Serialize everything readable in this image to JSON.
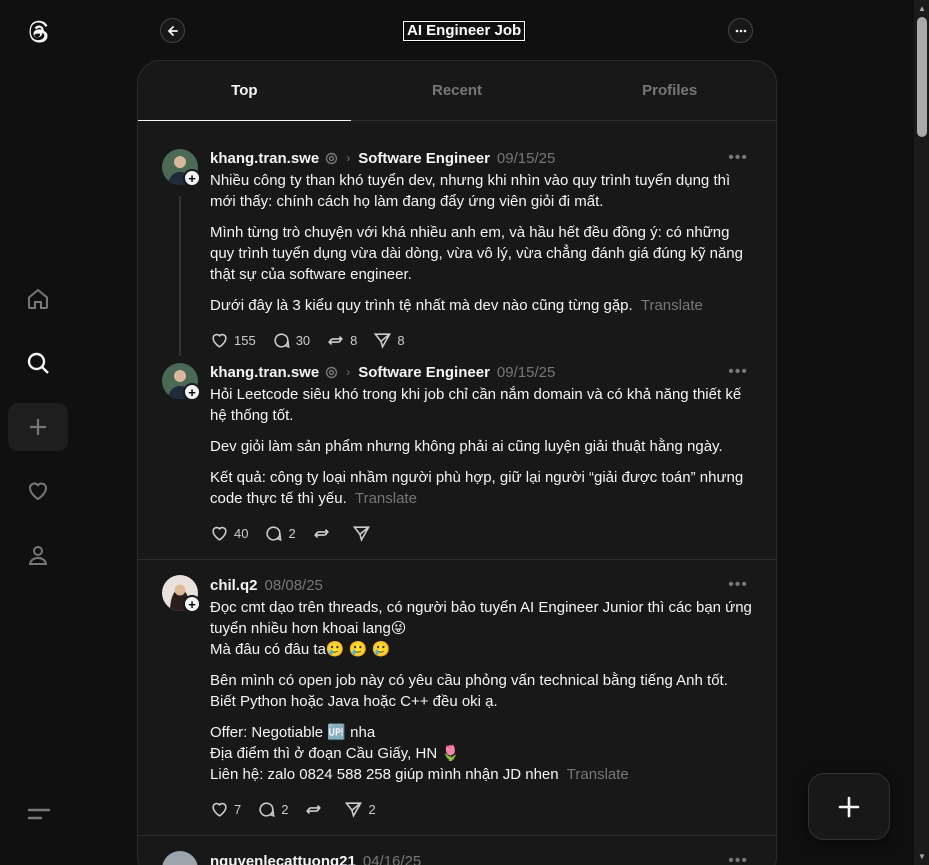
{
  "header": {
    "title": "AI Engineer Job"
  },
  "tabs": [
    {
      "label": "Top"
    },
    {
      "label": "Recent"
    },
    {
      "label": "Profiles"
    }
  ],
  "posts": [
    {
      "username": "khang.tran.swe",
      "topic": "Software Engineer",
      "date": "09/15/25",
      "paragraphs": [
        "Nhiều công ty than khó tuyển dev, nhưng khi nhìn vào quy trình tuyển dụng thì mới thấy: chính cách họ làm đang đẩy ứng viên giỏi đi mất.",
        "Mình từng trò chuyện với khá nhiều anh em, và hầu hết đều đồng ý: có những quy trình tuyển dụng vừa dài dòng, vừa vô lý, vừa chẳng đánh giá đúng kỹ năng thật sự của software engineer.",
        "Dưới đây là 3 kiểu quy trình tệ nhất mà dev nào cũng từng gặp."
      ],
      "translate": "Translate",
      "likes": "155",
      "replies": "30",
      "reposts": "8",
      "shares": "8"
    },
    {
      "username": "khang.tran.swe",
      "topic": "Software Engineer",
      "date": "09/15/25",
      "paragraphs": [
        "Hỏi Leetcode siêu khó trong khi job chỉ cần nắm domain và có khả năng thiết kế hệ thống tốt.",
        "Dev giỏi làm sản phẩm nhưng không phải ai cũng luyện giải thuật hằng ngày.",
        "Kết quả: công ty loại nhầm người phù hợp, giữ lại người “giải được toán” nhưng code thực tế thì yếu."
      ],
      "translate": "Translate",
      "likes": "40",
      "replies": "2",
      "reposts": "",
      "shares": ""
    },
    {
      "username": "chil.q2",
      "date": "08/08/25",
      "paragraphs": [
        "Đọc cmt dạo trên threads, có người bảo tuyển AI Engineer Junior thì các bạn ứng tuyển nhiều hơn khoai lang😜",
        "Mà đâu có đâu ta🥲 🥲 🥲",
        "Bên mình có open job này có yêu cầu phỏng vấn technical bằng tiếng Anh tốt.",
        "Biết Python hoặc Java hoặc C++ đều oki ạ.",
        "Offer: Negotiable 🆙 nha",
        "Địa điểm thì ở đoạn Cầu Giấy, HN 🌷",
        "Liên hệ: zalo 0824 588 258 giúp mình nhận JD nhen"
      ],
      "translate": "Translate",
      "likes": "7",
      "replies": "2",
      "reposts": "",
      "shares": "2"
    },
    {
      "username": "nguyenlecattuong21",
      "date": "04/16/25"
    }
  ],
  "icons": {
    "logo": "threads-logo-icon",
    "home": "home-icon",
    "search": "search-icon",
    "create": "plus-icon",
    "activity": "heart-icon",
    "profile": "person-icon",
    "menu": "menu-icon"
  },
  "colors": {
    "background": "#101010",
    "card": "#181818",
    "text": "#f3f5f7",
    "muted": "#777777"
  }
}
